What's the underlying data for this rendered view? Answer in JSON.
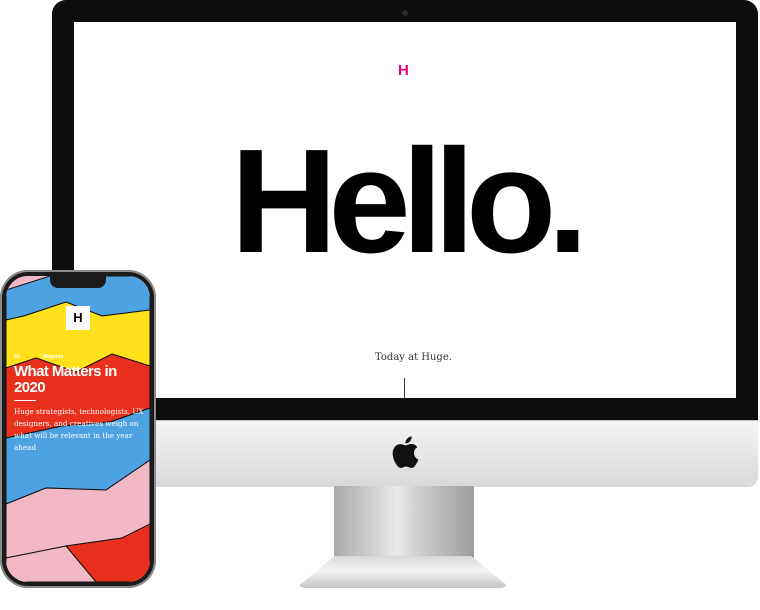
{
  "desktop": {
    "logo": "H",
    "headline": "Hello.",
    "tagline": "Today at Huge."
  },
  "mobile": {
    "logo": "H",
    "kicker_number": "01.",
    "kicker_label": "Magenta",
    "title": "What Matters in 2020",
    "description": "Huge strategists, technologists, UX designers, and creatives weigh on what will be relevant in the year ahead"
  },
  "colors": {
    "brand_magenta": "#e5007e",
    "panel_yellow": "#ffe01a",
    "panel_red": "#e8301c",
    "panel_blue": "#4da3e2",
    "panel_pink": "#f2b8c6"
  },
  "icons": {
    "apple": "apple-logo-icon"
  }
}
